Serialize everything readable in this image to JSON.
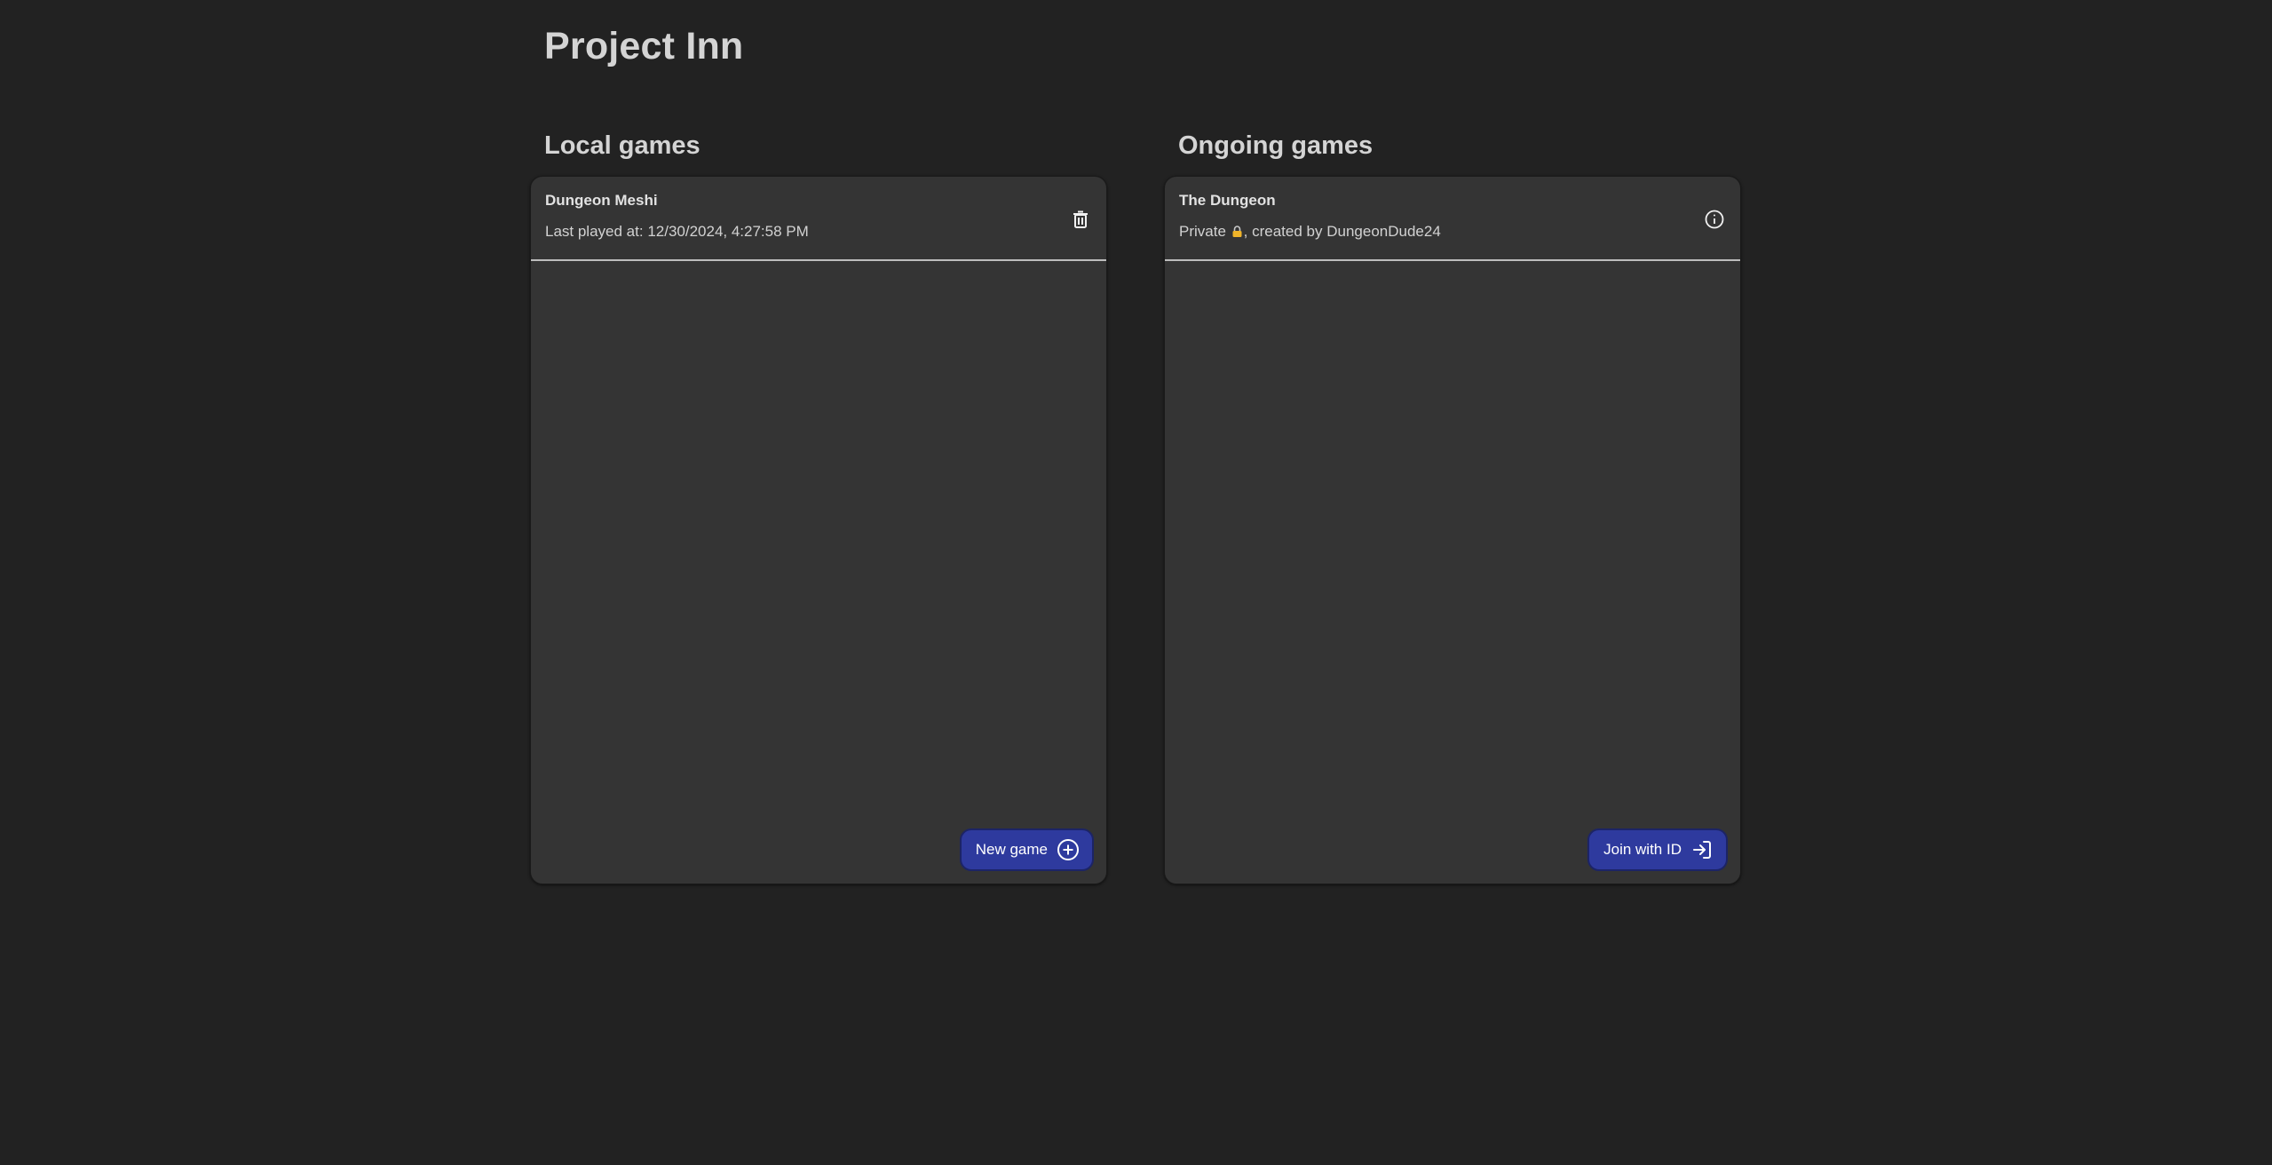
{
  "app": {
    "title": "Project Inn"
  },
  "local_games": {
    "heading": "Local games",
    "items": [
      {
        "name": "Dungeon Meshi",
        "meta_label": "Last played at: ",
        "meta_value": "12/30/2024, 4:27:58 PM",
        "action_icon": "trash-icon"
      }
    ],
    "button_label": "New game",
    "button_icon": "plus-circle-icon"
  },
  "ongoing_games": {
    "heading": "Ongoing games",
    "items": [
      {
        "name": "The Dungeon",
        "visibility": "Private",
        "lock_icon": "lock-icon",
        "creator_label": ", created by ",
        "creator": "DungeonDude24",
        "action_icon": "info-icon"
      }
    ],
    "button_label": "Join with ID",
    "button_icon": "login-icon"
  },
  "colors": {
    "background": "#222222",
    "panel": "#343434",
    "button": "#2e3a9e",
    "divider": "#bdbdbd",
    "lock": "#f0b429"
  }
}
